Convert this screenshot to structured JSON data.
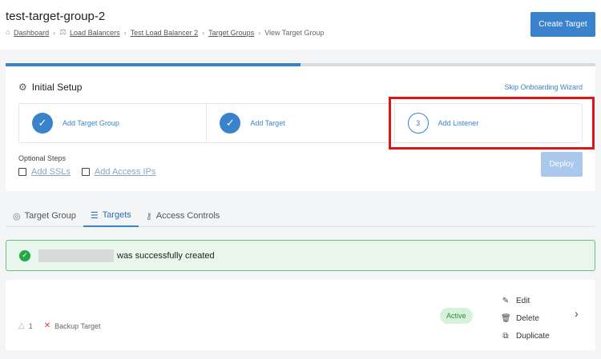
{
  "header": {
    "title": "test-target-group-2",
    "breadcrumb": [
      {
        "label": "Dashboard",
        "icon": "home-icon",
        "link": true
      },
      {
        "label": "Load Balancers",
        "icon": "load-balancer-icon",
        "link": true
      },
      {
        "label": "Test Load Balancer 2",
        "link": true
      },
      {
        "label": "Target Groups",
        "link": true
      },
      {
        "label": "View Target Group",
        "link": false
      }
    ],
    "create_button": "Create Target"
  },
  "onboarding": {
    "progress_fraction": 0.5,
    "title": "Initial Setup",
    "skip_link": "Skip Onboarding Wizard",
    "steps": [
      {
        "label": "Add Target Group",
        "done": true,
        "marker": "✓"
      },
      {
        "label": "Add Target",
        "done": true,
        "marker": "✓"
      },
      {
        "label": "Add Listener",
        "done": false,
        "marker": "3"
      }
    ],
    "optional_title": "Optional Steps",
    "optional_steps": [
      {
        "label": "Add SSLs"
      },
      {
        "label": "Add Access IPs"
      }
    ],
    "deploy_button": "Deploy"
  },
  "tabs": [
    {
      "label": "Target Group",
      "icon": "target-icon",
      "active": false
    },
    {
      "label": "Targets",
      "icon": "list-icon",
      "active": true
    },
    {
      "label": "Access Controls",
      "icon": "key-icon",
      "active": false
    }
  ],
  "alert": {
    "message": "was successfully created",
    "icon": "check-circle-icon"
  },
  "target": {
    "count": "1",
    "name": "Backup Target",
    "status": "Active",
    "actions": [
      {
        "label": "Edit",
        "icon": "pencil-icon"
      },
      {
        "label": "Delete",
        "icon": "trash-icon"
      },
      {
        "label": "Duplicate",
        "icon": "copy-icon"
      }
    ]
  },
  "colors": {
    "primary": "#3a83cc",
    "success": "#28a745",
    "highlight": "#e01515"
  }
}
